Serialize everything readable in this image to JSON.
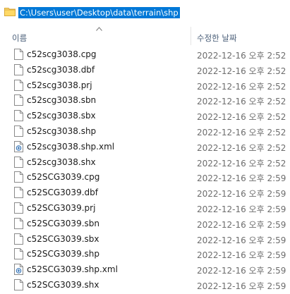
{
  "address": {
    "path": "C:\\Users\\user\\Desktop\\data\\terrain\\shp"
  },
  "columns": {
    "name": "이름",
    "date_modified": "수정한 날짜"
  },
  "files": [
    {
      "name": "c52scg3038.cpg",
      "date": "2022-12-16 오후 2:52",
      "icon": "document-icon"
    },
    {
      "name": "c52scg3038.dbf",
      "date": "2022-12-16 오후 2:52",
      "icon": "document-icon"
    },
    {
      "name": "c52scg3038.prj",
      "date": "2022-12-16 오후 2:52",
      "icon": "document-icon"
    },
    {
      "name": "c52scg3038.sbn",
      "date": "2022-12-16 오후 2:52",
      "icon": "document-icon"
    },
    {
      "name": "c52scg3038.sbx",
      "date": "2022-12-16 오후 2:52",
      "icon": "document-icon"
    },
    {
      "name": "c52scg3038.shp",
      "date": "2022-12-16 오후 2:52",
      "icon": "document-icon"
    },
    {
      "name": "c52scg3038.shp.xml",
      "date": "2022-12-16 오후 2:52",
      "icon": "xml-document-icon"
    },
    {
      "name": "c52scg3038.shx",
      "date": "2022-12-16 오후 2:52",
      "icon": "document-icon"
    },
    {
      "name": "c52SCG3039.cpg",
      "date": "2022-12-16 오후 2:59",
      "icon": "document-icon"
    },
    {
      "name": "c52SCG3039.dbf",
      "date": "2022-12-16 오후 2:59",
      "icon": "document-icon"
    },
    {
      "name": "c52SCG3039.prj",
      "date": "2022-12-16 오후 2:59",
      "icon": "document-icon"
    },
    {
      "name": "c52SCG3039.sbn",
      "date": "2022-12-16 오후 2:59",
      "icon": "document-icon"
    },
    {
      "name": "c52SCG3039.sbx",
      "date": "2022-12-16 오후 2:59",
      "icon": "document-icon"
    },
    {
      "name": "c52SCG3039.shp",
      "date": "2022-12-16 오후 2:59",
      "icon": "document-icon"
    },
    {
      "name": "c52SCG3039.shp.xml",
      "date": "2022-12-16 오후 2:59",
      "icon": "xml-document-icon"
    },
    {
      "name": "c52SCG3039.shx",
      "date": "2022-12-16 오후 2:59",
      "icon": "document-icon"
    }
  ],
  "colors": {
    "selection": "#0078d7",
    "header_text": "#4c607a",
    "date_text": "#6d6d6d"
  }
}
